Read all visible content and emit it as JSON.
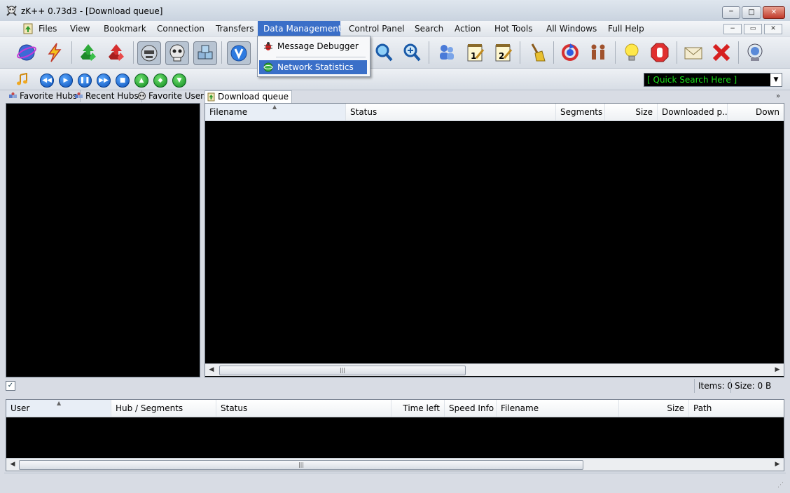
{
  "window": {
    "title": "zK++ 0.73d3  - [Download queue]",
    "min_glyph": "─",
    "max_glyph": "□",
    "close_glyph": "✕"
  },
  "menu": {
    "items": [
      "Files",
      "View",
      "Bookmark",
      "Connection",
      "Transfers",
      "Data Management",
      "Control Panel",
      "Search",
      "Action",
      "Hot Tools",
      "All Windows",
      "Full Help"
    ],
    "active": "Data Management",
    "dropdown": [
      "Message Debugger",
      "Network Statistics"
    ],
    "mdi_min": "−",
    "mdi_restore": "▭",
    "mdi_close": "✕"
  },
  "quick_search": {
    "text": "[ Quick Search Here ]",
    "arrow": "▼"
  },
  "tabs": [
    "Favorite Hubs",
    "Recent Hubs",
    "Favorite Users",
    "Download queue"
  ],
  "tab_scroll_glyph": "»",
  "queue": {
    "columns": [
      "Filename",
      "Status",
      "Segments",
      "Size",
      "Downloaded p...",
      "Down"
    ]
  },
  "mid_status": {
    "checkbox": "✓",
    "items": "Items: 0",
    "size": "Size: 0 B"
  },
  "transfers": {
    "columns": [
      "User",
      "Hub / Segments",
      "Status",
      "Time left",
      "Speed Info",
      "Filename",
      "Size",
      "Path"
    ]
  },
  "scroll": {
    "left": "◀",
    "right": "▶",
    "grip": "|||"
  },
  "sort_glyph": "▲",
  "resize_grip": "⋰",
  "colors": {
    "accent": "#3a6fc8",
    "search_text": "#19e019"
  }
}
